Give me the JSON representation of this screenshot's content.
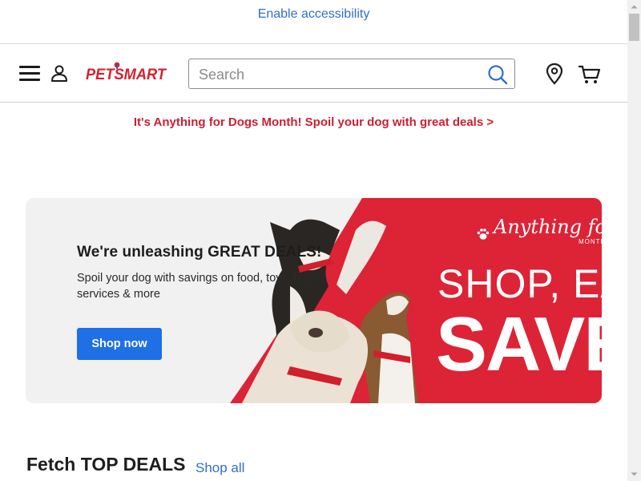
{
  "accessibility": {
    "link_label": "Enable accessibility"
  },
  "header": {
    "logo_text": "PETSMART",
    "search": {
      "placeholder": "Search",
      "value": ""
    },
    "icons": [
      "menu-icon",
      "account-icon",
      "search-icon",
      "store-locator-icon",
      "cart-icon"
    ]
  },
  "promo_banner": {
    "text": "It's Anything for Dogs Month! Spoil your dog with great deals >"
  },
  "hero": {
    "title": "We're unleashing GREAT DEALS!",
    "subtitle": "Spoil your dog with savings on food, toys, beds, services & more",
    "button_label": "Shop now",
    "campaign_script": "Anything for Dogs",
    "campaign_month": "MONTH",
    "headline_line1": "SHOP, EAT,",
    "headline_line2": "SAVE"
  },
  "deals_section": {
    "title": "Fetch TOP DEALS",
    "link_label": "Shop all"
  },
  "colors": {
    "brand_red": "#cc1f34",
    "hero_red": "#dd2336",
    "link_blue": "#2f6fce",
    "button_blue": "#1f6fe5"
  }
}
